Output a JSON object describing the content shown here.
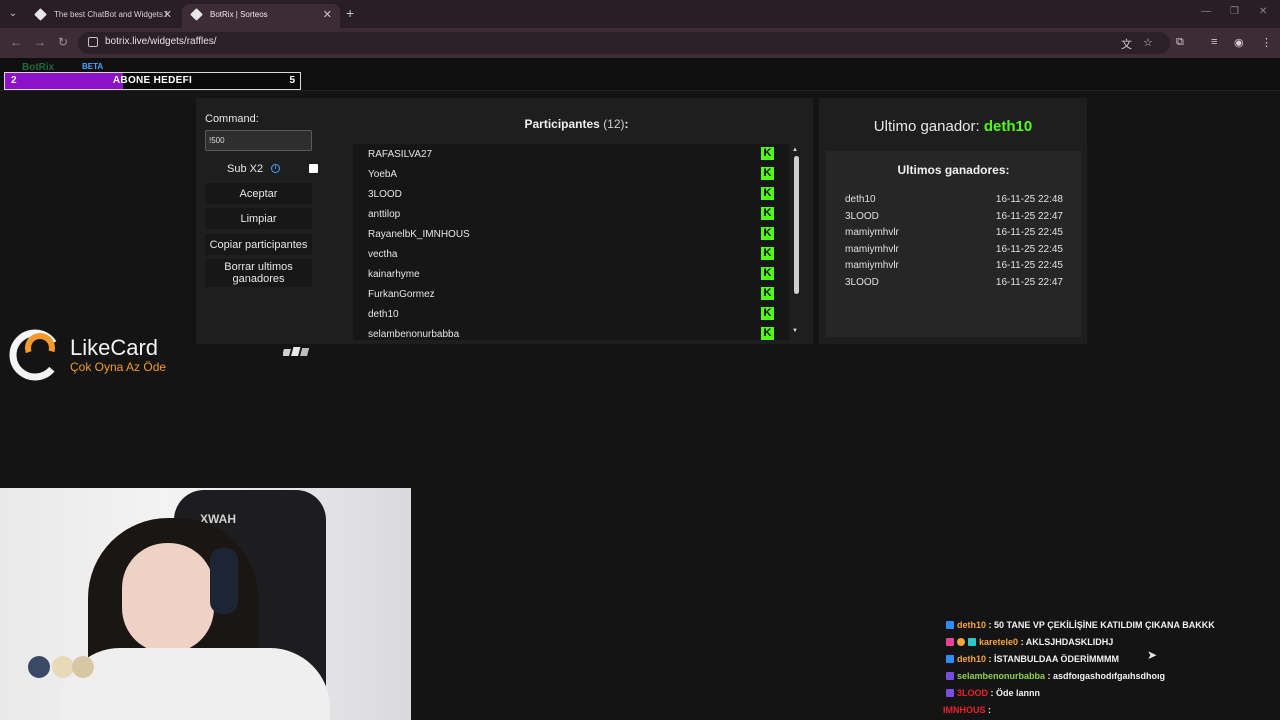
{
  "browser": {
    "tabs": [
      {
        "title": "The best ChatBot and Widgets f"
      },
      {
        "title": "BotRix | Sorteos"
      }
    ],
    "url": "botrix.live/widgets/raffles/"
  },
  "overlay": {
    "brand": "BotRix",
    "beta": "BETA",
    "goal": {
      "current": "2",
      "label": "ABONE HEDEFI",
      "target": "5",
      "progress": 0.4
    }
  },
  "raffle": {
    "command_label": "Command:",
    "command_value": "!500",
    "sub_label": "Sub X2",
    "buttons": {
      "accept": "Aceptar",
      "clear": "Limpiar",
      "copy": "Copiar participantes",
      "delete": "Borrar ultimos ganadores"
    },
    "participants_title": "Participantes",
    "participants_count": "(12)",
    "participants_colon": ":",
    "participants": [
      "RAFASILVA27",
      "YoebA",
      "3LOOD",
      "anttilop",
      "RayanelbK_IMNHOUS",
      "vectha",
      "kainarhyme",
      "FurkanGormez",
      "deth10",
      "selambenonurbabba"
    ],
    "last_winner_label": "Ultimo ganador:",
    "last_winner": "deth10",
    "winners_title": "Ultimos ganadores:",
    "winners": [
      {
        "name": "deth10",
        "date": "16-11-25 22:48"
      },
      {
        "name": "3LOOD",
        "date": "16-11-25 22:47"
      },
      {
        "name": "mamiymhvlr",
        "date": "16-11-25 22:45"
      },
      {
        "name": "mamiymhvlr",
        "date": "16-11-25 22:45"
      },
      {
        "name": "mamiymhvlr",
        "date": "16-11-25 22:45"
      },
      {
        "name": "3LOOD",
        "date": "16-11-25 22:47"
      }
    ]
  },
  "sponsor": {
    "name": "LikeCard",
    "tagline": "Çok Oyna  Az Öde"
  },
  "webcam": {
    "chair_text": "XWAH"
  },
  "chat": [
    {
      "user": "deth10",
      "user_color": "#f6a53a",
      "text": ": 50 TANE VP ÇEKİLİŞİNE KATILDIM ÇIKANA BAKKK"
    },
    {
      "user": "karetele0",
      "user_color": "#f6a53a",
      "text": ": AKLSJHDASKLIDHJ"
    },
    {
      "user": "deth10",
      "user_color": "#f6a53a",
      "text": ": İSTANBULDAA ÖDERİMMMM"
    },
    {
      "user": "selambenonurbabba",
      "user_color": "#8fd14f",
      "text": ": asdfoıgashodıfgaıhsdhoıg"
    },
    {
      "user": "3LOOD",
      "user_color": "#e8242b",
      "text": ": Öde lannn"
    },
    {
      "user": "IMNHOUS",
      "user_color": "#e8242b",
      "text": ":"
    }
  ]
}
